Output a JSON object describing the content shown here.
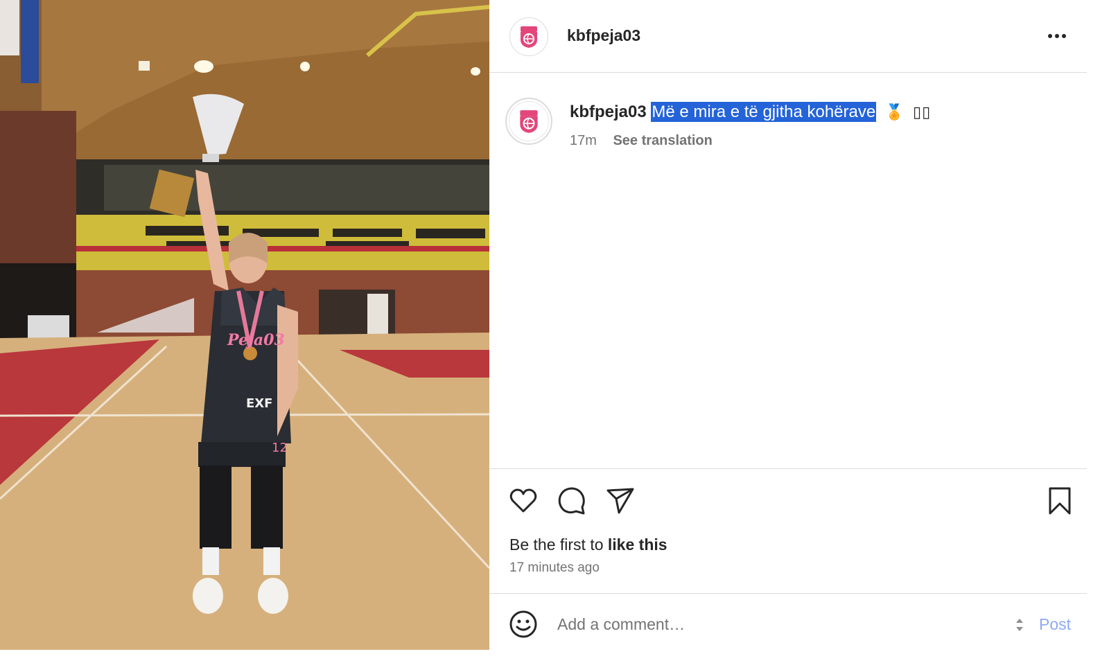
{
  "post": {
    "username": "kbfpeja03",
    "caption_text": "Më e mira e të gjitha kohërave",
    "caption_emoji": "🏅",
    "caption_boxes": "▯▯",
    "time_short": "17m",
    "see_translation": "See translation",
    "likes_prefix": "Be the first to ",
    "likes_action": "like this",
    "time_long": "17 minutes ago"
  },
  "comment_box": {
    "placeholder": "Add a comment…",
    "post_label": "Post"
  },
  "photo": {
    "jersey_text": "Peja03",
    "sponsor_text": "EXF",
    "number": "12"
  },
  "icons": {
    "more": "more-options-icon",
    "like": "heart-icon",
    "comment": "comment-bubble-icon",
    "share": "paper-plane-icon",
    "save": "bookmark-icon",
    "emoji": "smiley-icon"
  },
  "colors": {
    "selection": "#2463d8",
    "post_button": "#8ea8f5",
    "brand_pink": "#e3467a"
  }
}
